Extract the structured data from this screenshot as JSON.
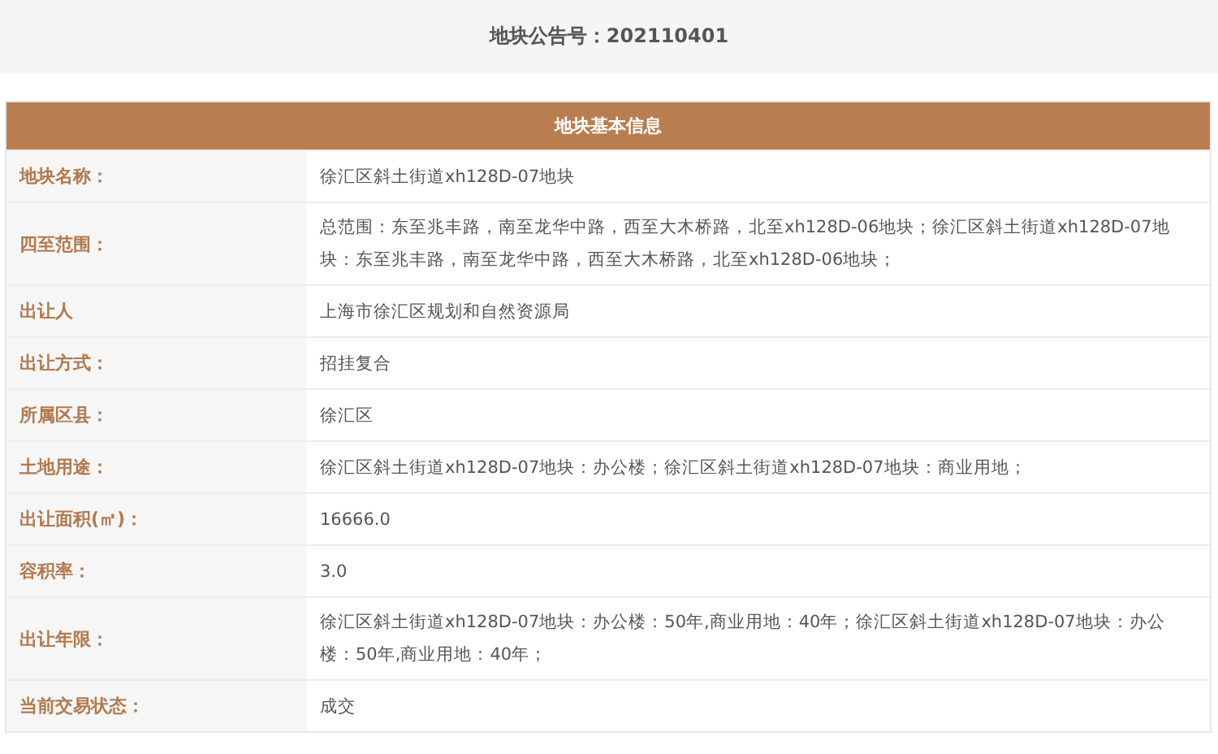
{
  "announcement": {
    "label": "地块公告号：",
    "number": "202110401"
  },
  "table": {
    "title": "地块基本信息",
    "rows": [
      {
        "label": "地块名称：",
        "value": "徐汇区斜土街道xh128D-07地块"
      },
      {
        "label": "四至范围：",
        "value": "总范围：东至兆丰路，南至龙华中路，西至大木桥路，北至xh128D-06地块；徐汇区斜土街道xh128D-07地块：东至兆丰路，南至龙华中路，西至大木桥路，北至xh128D-06地块；"
      },
      {
        "label": "出让人",
        "value": "上海市徐汇区规划和自然资源局"
      },
      {
        "label": "出让方式：",
        "value": "招挂复合"
      },
      {
        "label": "所属区县：",
        "value": "徐汇区"
      },
      {
        "label": "土地用途：",
        "value": "徐汇区斜土街道xh128D-07地块：办公楼；徐汇区斜土街道xh128D-07地块：商业用地；"
      },
      {
        "label": "出让面积(㎡)：",
        "value": "16666.0"
      },
      {
        "label": "容积率：",
        "value": "3.0"
      },
      {
        "label": "出让年限：",
        "value": "徐汇区斜土街道xh128D-07地块：办公楼：50年,商业用地：40年；徐汇区斜土街道xh128D-07地块：办公楼：50年,商业用地：40年；"
      },
      {
        "label": "当前交易状态：",
        "value": "成交"
      }
    ]
  }
}
